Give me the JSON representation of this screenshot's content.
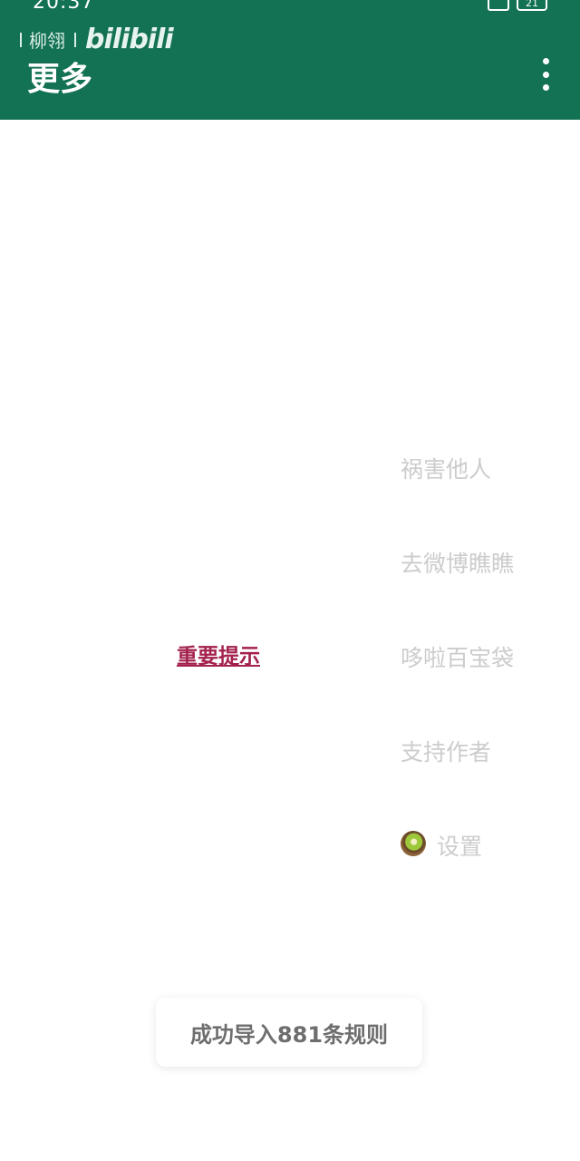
{
  "status_bar": {
    "time": "20:37",
    "battery": "21"
  },
  "brand": {
    "author": "柳翎",
    "logo_text": "bilibili"
  },
  "appbar": {
    "title": "更多",
    "overflow_icon": "more-vert-icon",
    "background_color": "#137154"
  },
  "notice": {
    "label": "重要提示",
    "color": "#a3224d"
  },
  "menu": {
    "items": [
      {
        "label": "祸害他人"
      },
      {
        "label": "去微博瞧瞧"
      },
      {
        "label": "哆啦百宝袋"
      },
      {
        "label": "支持作者"
      },
      {
        "label": "设置",
        "icon": "kiwi-icon"
      }
    ]
  },
  "toast": {
    "message": "成功导入881条规则"
  }
}
